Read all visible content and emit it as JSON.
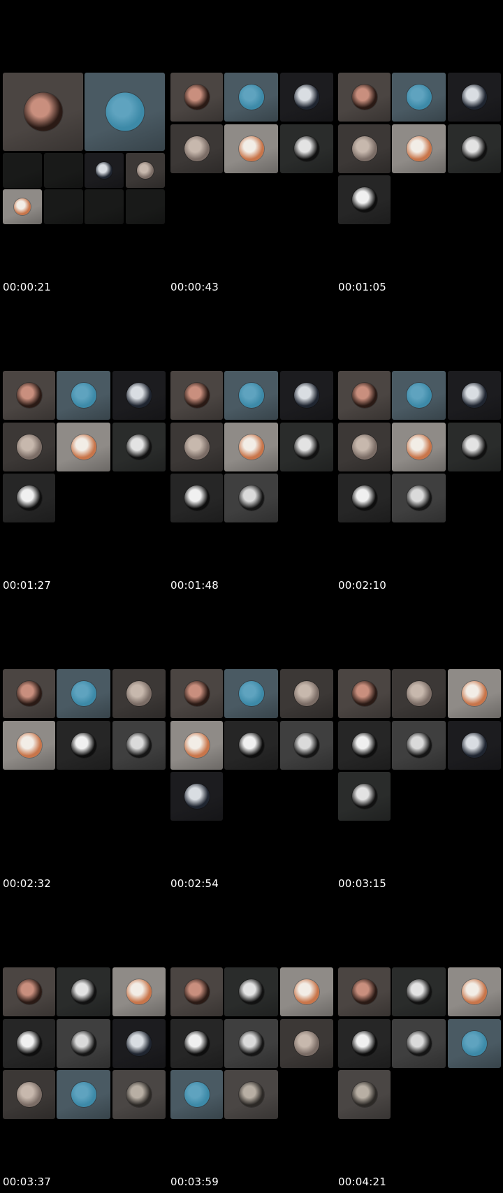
{
  "sheet": {
    "frames": [
      {
        "timestamp": "00:00:21",
        "layout": "speaker",
        "tiles": [
          "portrait-warm",
          "sea",
          "empty",
          "empty",
          "man-dark",
          "room-door",
          "food-bright",
          "empty",
          "empty",
          "empty"
        ]
      },
      {
        "timestamp": "00:00:43",
        "layout": "grid",
        "tiles": [
          "portrait-warm",
          "sea",
          "man-dark",
          "room-door",
          "food-bright",
          "arch-dark"
        ]
      },
      {
        "timestamp": "00:01:05",
        "layout": "grid",
        "tiles": [
          "portrait-warm",
          "sea",
          "man-dark",
          "room-door",
          "food-bright",
          "arch-dark",
          "bw-swirl"
        ]
      },
      {
        "timestamp": "00:01:27",
        "layout": "grid",
        "tiles": [
          "portrait-warm",
          "sea",
          "man-dark",
          "room-door",
          "food-bright",
          "arch-dark",
          "bw-swirl"
        ]
      },
      {
        "timestamp": "00:01:48",
        "layout": "grid",
        "tiles": [
          "portrait-warm",
          "sea",
          "man-dark",
          "room-door",
          "food-bright",
          "arch-dark",
          "bw-swirl",
          "bw-pattern"
        ]
      },
      {
        "timestamp": "00:02:10",
        "layout": "grid",
        "tiles": [
          "portrait-warm",
          "sea",
          "man-dark",
          "room-door",
          "food-bright",
          "arch-dark",
          "bw-swirl",
          "bw-pattern"
        ]
      },
      {
        "timestamp": "00:02:32",
        "layout": "grid",
        "tiles": [
          "portrait-warm",
          "sea",
          "room-door",
          "food-bright",
          "bw-swirl",
          "bw-pattern"
        ]
      },
      {
        "timestamp": "00:02:54",
        "layout": "grid",
        "tiles": [
          "portrait-warm",
          "sea",
          "room-door",
          "food-bright",
          "bw-swirl",
          "bw-pattern",
          "man-dark"
        ]
      },
      {
        "timestamp": "00:03:15",
        "layout": "grid",
        "tiles": [
          "portrait-warm",
          "room-door",
          "food-bright",
          "bw-swirl",
          "bw-pattern",
          "man-dark",
          "arch-dark"
        ]
      },
      {
        "timestamp": "00:03:37",
        "layout": "grid",
        "tiles": [
          "portrait-warm",
          "arch-dark",
          "food-bright",
          "bw-swirl",
          "bw-pattern",
          "man-dark",
          "room-door",
          "sea",
          "people-bw"
        ]
      },
      {
        "timestamp": "00:03:59",
        "layout": "grid",
        "tiles": [
          "portrait-warm",
          "arch-dark",
          "food-bright",
          "bw-swirl",
          "bw-pattern",
          "room-door",
          "sea",
          "people-bw"
        ]
      },
      {
        "timestamp": "00:04:21",
        "layout": "grid",
        "tiles": [
          "portrait-warm",
          "arch-dark",
          "food-bright",
          "bw-swirl",
          "bw-pattern",
          "sea",
          "people-bw"
        ]
      }
    ]
  },
  "participants": {
    "portrait-warm": {
      "icon": "portrait-avatar-icon",
      "bg": "#4b4542",
      "a": "#c98f7e",
      "b": "#2a1a15"
    },
    "sea": {
      "icon": "sea-avatar-icon",
      "bg": "#4a5a63",
      "a": "#5fa3bf",
      "b": "#3d8aa8"
    },
    "man-dark": {
      "icon": "man-avatar-icon",
      "bg": "#1c1c1f",
      "a": "#d9dde2",
      "b": "#1f2530"
    },
    "room-door": {
      "icon": "room-avatar-icon",
      "bg": "#3c3836",
      "a": "#c7b8ad",
      "b": "#7b6d66"
    },
    "food-bright": {
      "icon": "food-avatar-icon",
      "bg": "#8f8b87",
      "a": "#f2ede6",
      "b": "#c8754a"
    },
    "arch-dark": {
      "icon": "arch-avatar-icon",
      "bg": "#2a2c2b",
      "a": "#e3e3e3",
      "b": "#111111"
    },
    "bw-swirl": {
      "icon": "swirl-avatar-icon",
      "bg": "#262626",
      "a": "#f0f0f0",
      "b": "#0e0e0e"
    },
    "bw-pattern": {
      "icon": "pattern-avatar-icon",
      "bg": "#3f3f3f",
      "a": "#dadada",
      "b": "#151515"
    },
    "people-bw": {
      "icon": "people-avatar-icon",
      "bg": "#4a4644",
      "a": "#b8afa4",
      "b": "#2c2926"
    },
    "empty": {
      "icon": "",
      "bg": "#191a19",
      "a": "",
      "b": ""
    }
  }
}
